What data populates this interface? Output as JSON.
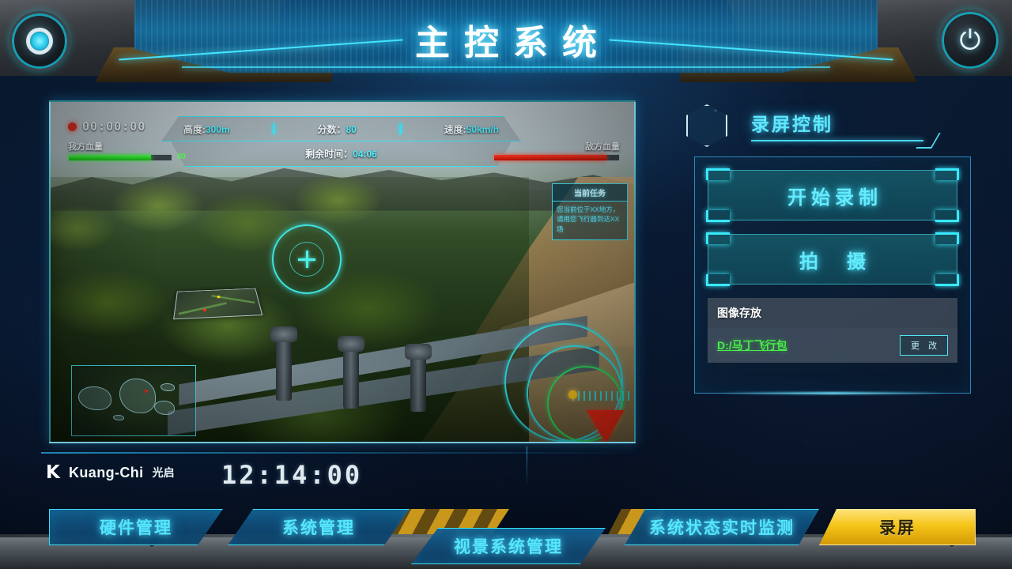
{
  "window": {
    "title": "主控系统"
  },
  "top_controls": {
    "left_knob_name": "indicator-dial",
    "power_label": "⏻"
  },
  "viewport": {
    "recording": {
      "dot": "●",
      "time": "00:00:00"
    },
    "hud": {
      "altitude": {
        "label": "高度:",
        "value": "300m"
      },
      "score": {
        "label": "分数：",
        "value": "80"
      },
      "speed": {
        "label": "速度:",
        "value": "50km/h"
      },
      "time_left": {
        "label": "剩余时间：",
        "value": "04:06"
      },
      "own_hp": {
        "label": "我方血量",
        "value": "80",
        "percent": 80,
        "color": "#2ef42e"
      },
      "enemy_hp": {
        "label": "敌方血量",
        "value": "90",
        "percent": 90,
        "color": "#ff3a25"
      }
    },
    "mission": {
      "header": "当前任务",
      "body": "您当前位于XX地方，请用您飞行器到达XX场"
    }
  },
  "right_panel": {
    "title": "录屏控制",
    "buttons": [
      {
        "label": "开始录制",
        "name": "start-recording-button"
      },
      {
        "label": "拍　摄",
        "name": "capture-button"
      }
    ],
    "storage": {
      "header": "图像存放",
      "path": "D:/马丁飞行包",
      "change_label": "更 改"
    }
  },
  "footer": {
    "brand_mark": "K",
    "brand_name": "Kuang-Chi",
    "brand_cn": "光启",
    "clock": "12:14:00"
  },
  "nav": {
    "tabs": [
      {
        "label": "硬件管理",
        "active": false
      },
      {
        "label": "系统管理",
        "active": false
      },
      {
        "label": "视景系统管理",
        "active": false
      },
      {
        "label": "系统状态实时监测",
        "active": false
      },
      {
        "label": "录屏",
        "active": true
      }
    ]
  },
  "colors": {
    "accent_cyan": "#55e6ff",
    "accent_yellow": "#f5c518",
    "hp_green": "#2ef42e",
    "hp_red": "#ff3a25",
    "path_green": "#48ee48"
  }
}
